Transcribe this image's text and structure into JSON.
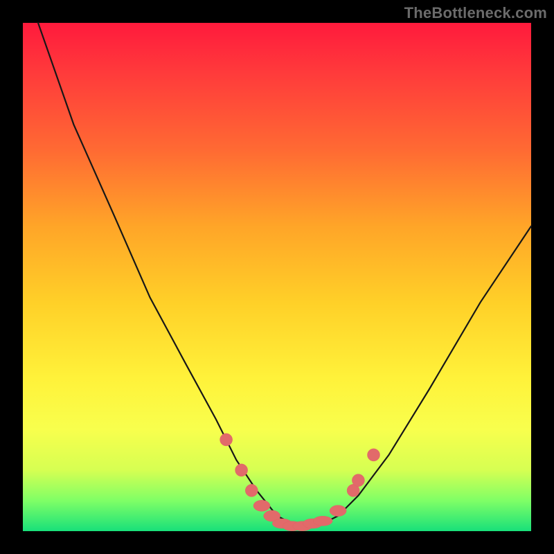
{
  "watermark": "TheBottleneck.com",
  "colors": {
    "frame_bg": "#000000",
    "gradient_top": "#ff1a3c",
    "gradient_bottom": "#18e07a",
    "curve": "#171717",
    "marker": "#e26a6a"
  },
  "chart_data": {
    "type": "line",
    "title": "",
    "xlabel": "",
    "ylabel": "",
    "xlim": [
      0,
      100
    ],
    "ylim": [
      0,
      100
    ],
    "grid": false,
    "series": [
      {
        "name": "curve",
        "x": [
          3,
          10,
          18,
          25,
          32,
          38,
          42,
          46,
          50,
          54,
          58,
          62,
          66,
          72,
          80,
          90,
          100
        ],
        "values": [
          100,
          80,
          62,
          46,
          33,
          22,
          14,
          8,
          3,
          1,
          1,
          3,
          7,
          15,
          28,
          45,
          60
        ]
      },
      {
        "name": "markers",
        "x": [
          40,
          43,
          45,
          47,
          49,
          51,
          53,
          55,
          57,
          59,
          62,
          65,
          66,
          69
        ],
        "values": [
          18,
          12,
          8,
          5,
          3,
          1.5,
          1,
          1,
          1.5,
          2,
          4,
          8,
          10,
          15
        ]
      }
    ]
  }
}
